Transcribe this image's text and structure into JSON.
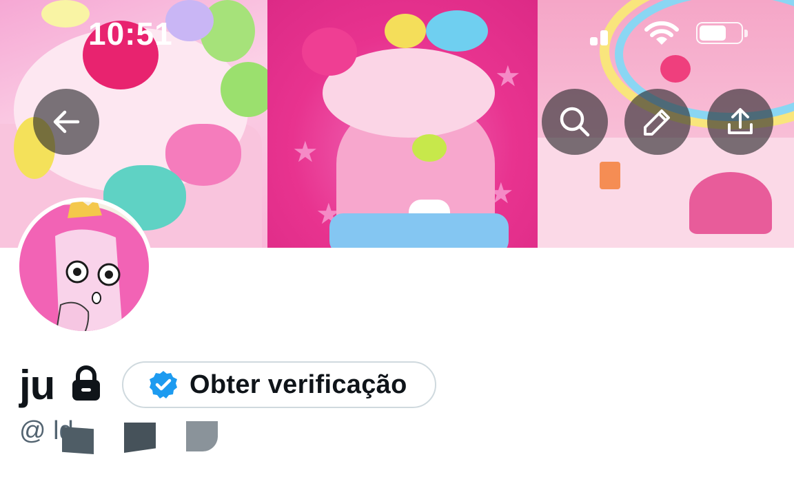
{
  "status_bar": {
    "time": "10:51",
    "icons": [
      "cellular-signal-icon",
      "wifi-icon",
      "battery-icon"
    ]
  },
  "header": {
    "buttons": [
      {
        "name": "back-button",
        "icon": "arrow-left-icon"
      },
      {
        "name": "search-button",
        "icon": "search-icon"
      },
      {
        "name": "edit-button",
        "icon": "pencil-icon"
      },
      {
        "name": "share-button",
        "icon": "share-upload-icon"
      }
    ],
    "banner_description": [
      "pink ice cream cup with candy hearts",
      "pink frosted milkshake with sweets",
      "pink candy shop storefront"
    ]
  },
  "profile": {
    "display_name": "ju",
    "protected_icon": "lock-icon",
    "verify_button": {
      "label": "Obter verificação",
      "icon": "verified-badge-icon",
      "icon_color": "#1d9bf0"
    },
    "handle_visible": "@ ld",
    "avatar_description": "pink cartoon princess avatar"
  },
  "colors": {
    "accent": "#1d9bf0",
    "text_primary": "#0f1419",
    "text_secondary": "#536471",
    "border": "#cfd9de",
    "overlay_button": "rgba(40,40,44,0.62)"
  }
}
